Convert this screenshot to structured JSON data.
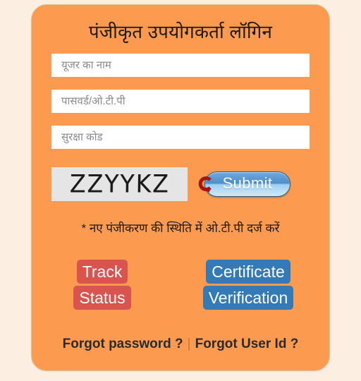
{
  "panel": {
    "title": "पंजीकृत उपयोगकर्ता लॉगिन",
    "background_color": "#FC9A4F",
    "page_background_color": "#FCEEE0"
  },
  "form": {
    "username": {
      "value": "",
      "placeholder": "यूजर का नाम"
    },
    "password": {
      "value": "",
      "placeholder": "पासवर्ड/ओ.टी.पी"
    },
    "security_code": {
      "value": "",
      "placeholder": "सुरक्षा कोड"
    }
  },
  "captcha": {
    "text": "ZZYYKZ",
    "background_color": "#E5E5E5",
    "refresh_icon": "refresh-arrow-icon"
  },
  "submit": {
    "label": "Submit",
    "color": "#4E8FCB"
  },
  "note": {
    "text": "* नए पंजीकरण की स्थिति में ओ.टी.पी दर्ज करें"
  },
  "actions": [
    {
      "label": "Track Status",
      "line1": "Track",
      "line2": "Status",
      "color": "#D9534F",
      "name": "track-status-button"
    },
    {
      "label": "Certificate Verification",
      "line1": "Certificate",
      "line2": "Verification",
      "color": "#337AB7",
      "name": "certificate-verification-button"
    }
  ],
  "footer": {
    "forgot_password": "Forgot password ?",
    "separator": "|",
    "forgot_user_id": "Forgot User Id ?"
  }
}
